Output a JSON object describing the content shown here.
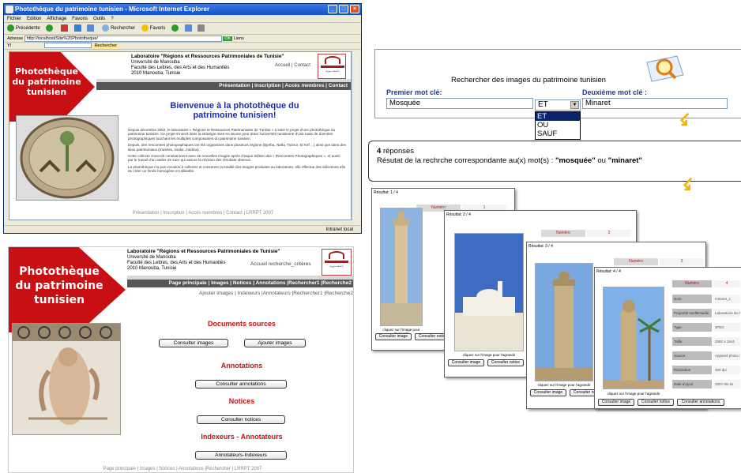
{
  "browser": {
    "title": "Photothèque du patrimoine tunisien - Microsoft Internet Explorer",
    "menu": [
      "Fichier",
      "Edition",
      "Affichage",
      "Favoris",
      "Outils",
      "?"
    ],
    "toolbar": [
      "Précédente",
      "Rechercher",
      "Favoris"
    ],
    "address_label": "Adresse",
    "address": "http://localhost/Site%20Phototheque/",
    "go": "OK",
    "links": "Liens",
    "search_box": "Rechercher",
    "status": "Intranet local"
  },
  "site": {
    "banner_text": [
      "Photothèque",
      "du patrimoine",
      "tunisien"
    ],
    "lab_name": "Laboratoire \"Régions et Ressources Patrimoniales de Tunisie\"",
    "lab_lines": [
      "Université de Manouba",
      "Faculté des Lettres, des Arts et des Humanités",
      "2010 Manouba, Tunisie"
    ],
    "emblem_text": "جامعة منوبة"
  },
  "home": {
    "right_links": "Accueil | Contact",
    "nav": "Présentation | Inscription | Accès membres | Contact",
    "welcome": "Bienvenue à la photothèque du patrimoine tunisien!",
    "p1": "Depuis décembre 2002, le laboratoire « Régions et Ressources Patrimoniales de Tunisie » a initié le projet d'une photothèque du patrimoine tunisien. Ce projet s'inscrit dans la stratégie mise en œuvre pour doter l'université tunisienne d'une base de données photographiques touchant les multiples composantes du patrimoine tunisien.",
    "p2": "Depuis, des rencontres photographiques ont été organisées dans plusieurs régions (Djerba, Nafta, Tozeur, El Kef ...) ainsi que dans des lieux patrimoniaux (musées, souks, médina).",
    "p3": "Cette collecte s'accroît constamment avec de nouvelles images après chaque édition des « Rencontres Photographiques », et aussi par le travail d'un atelier de suivi qui assure la révision des résultats obtenus.",
    "p4": "La photothèque n'a pas vocation à collecter et conserver la totalité des images produites au laboratoire, elle effectue des sélections afin de créer un fonds homogène et utilisable.",
    "footer": "Présentation | Inscription | Accès membres | Contact | LRRPT 2007"
  },
  "admin": {
    "right_links": "Accueil  recherche_critères",
    "nav": "Page principale | Images | Notices | Annotations |Rechercher1 |Recherche2",
    "subnav": "Ajouter images | Indexeurs |Annotateurs |Rechercher1 |Recherche2",
    "docs_title": "Documents sources",
    "btn_consult_images": "Consulter images",
    "btn_add_images": "Ajouter images",
    "annot_title": "Annotations",
    "btn_consult_annot": "Consulter annotations",
    "notices_title": "Notices",
    "btn_consult_notices": "Consulter notices",
    "index_title": "Indexeurs - Annotateurs",
    "btn_index": "Annotateurs-Indexeurs",
    "footer": "Page principale | Images | Notices | Annotations |Rechercher | LRRPT 2007"
  },
  "search": {
    "title": "Rechercher des images du patrimoine tunisien",
    "label1": "Premier mot clé:",
    "label2": "Deuxième mot clé :",
    "value1": "Mosquée",
    "operator": "ET",
    "value2": "Minaret",
    "options": [
      "ET",
      "OU",
      "SAUF"
    ]
  },
  "results": {
    "count": "4",
    "count_label": "réponses",
    "prefix": "Résutat de la rechrche correspondante au(x) mot(s) :",
    "word1": "\"mosquée\"",
    "join": "ou",
    "word2": "\"minaret\""
  },
  "cards": [
    {
      "result": "Résultat: 1 / 4",
      "numero": "1"
    },
    {
      "result": "Résultat: 2 / 4",
      "numero": "2"
    },
    {
      "result": "Résultat: 3 / 4",
      "numero": "3"
    },
    {
      "result": "Résultat: 4 / 4",
      "numero": "4"
    }
  ],
  "card_labels": {
    "numero": "Numéro",
    "caption": "cliquez sur l'image pour l'agrandir",
    "btn_image": "Consulter image",
    "btn_notice": "Consulter notice",
    "btn_annot": "Consulter annotations"
  },
  "card4_table": [
    {
      "k": "Nom",
      "v": "minaret_1"
    },
    {
      "k": "Propriété intellectuelle",
      "v": "Laboratoire du Pat"
    },
    {
      "k": "Type",
      "v": "JPEG"
    },
    {
      "k": "Taille",
      "v": "2592 x 1944"
    },
    {
      "k": "Source",
      "v": "Appareil photo num"
    },
    {
      "k": "Résolution",
      "v": "300 dpi"
    },
    {
      "k": "Date d'Ajout",
      "v": "2007-06-15"
    }
  ]
}
